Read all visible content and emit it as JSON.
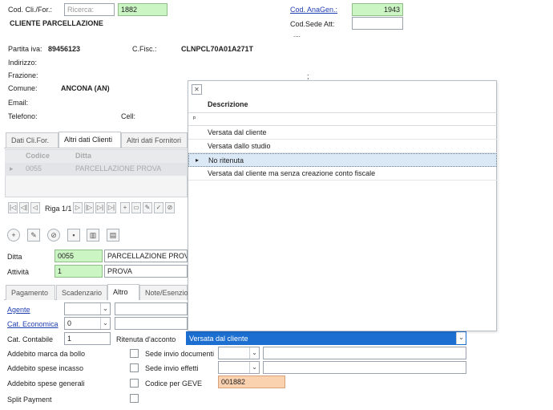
{
  "header": {
    "cod_cli_label": "Cod. Cli./For.:",
    "ricerca_placeholder": "Ricerca:",
    "cod_cli_value": "1882",
    "cod_anagen_label": "Cod. AnaGen.:",
    "cod_anagen_value": "1943",
    "cod_sede_label": "Cod.Sede Att:",
    "cod_sede_value": "",
    "ellipsis": "....",
    "client_name": "CLIENTE PARCELLAZIONE"
  },
  "info": {
    "partita_iva_label": "Partita iva:",
    "partita_iva_value": "89456123",
    "cfisc_label": "C.Fisc.:",
    "cfisc_value": "CLNPCL70A01A271T",
    "indirizzo_label": "Indirizzo:",
    "frazione_label": "Frazione:",
    "comune_label": "Comune:",
    "comune_value": "ANCONA (AN)",
    "email_label": "Email:",
    "telefono_label": "Telefono:",
    "cell_label": "Cell:",
    "semicolon": ";"
  },
  "tabs_top": [
    "Dati Cli.For.",
    "Altri dati Clienti",
    "Altri dati Fornitori"
  ],
  "grid": {
    "col_codice": "Codice",
    "col_ditta": "Ditta",
    "row_codice": "0055",
    "row_ditta": "PARCELLAZIONE PROVA"
  },
  "navigator": {
    "riga_label": "Riga 1/1"
  },
  "ditta": {
    "ditta_label": "Ditta",
    "ditta_code": "0055",
    "ditta_name": "PARCELLAZIONE PROVA",
    "attivita_label": "Attività",
    "attivita_code": "1",
    "attivita_name": "PROVA"
  },
  "tabs_bottom": [
    "Pagamento",
    "Scadenzario",
    "Altro",
    "Note/Esenzio"
  ],
  "altro": {
    "agente_label": "Agente",
    "agente_value": "",
    "cat_economica_label": "Cat. Economica",
    "cat_economica_value": "0",
    "cat_contabile_label": "Cat. Contabile",
    "cat_contabile_value": "1",
    "ritenuta_label": "Ritenuta d'acconto",
    "ritenuta_value": "Versata dal cliente",
    "addebito_bollo_label": "Addebito marca da bollo",
    "addebito_incasso_label": "Addebito spese incasso",
    "addebito_generali_label": "Addebito spese generali",
    "split_payment_label": "Split Payment",
    "sede_documenti_label": "Sede invio documenti",
    "sede_effetti_label": "Sede invio effetti",
    "codice_geve_label": "Codice per GEVE",
    "codice_geve_value": "001882"
  },
  "popup": {
    "close_glyph": "✕",
    "header": "Descrizione",
    "filter_glyph": "ᵖ",
    "rows": [
      "Versata dal cliente",
      "Versata dallo studio",
      "No ritenuta",
      "Versata dal cliente ma senza creazione conto fiscale"
    ],
    "selected_index": 2,
    "row_marker": "▸"
  },
  "colors": {
    "green_field": "#ccf5c4",
    "orange_field": "#fbd2b0",
    "selected_combo": "#1c6fd1",
    "link": "#1f3fb0"
  }
}
